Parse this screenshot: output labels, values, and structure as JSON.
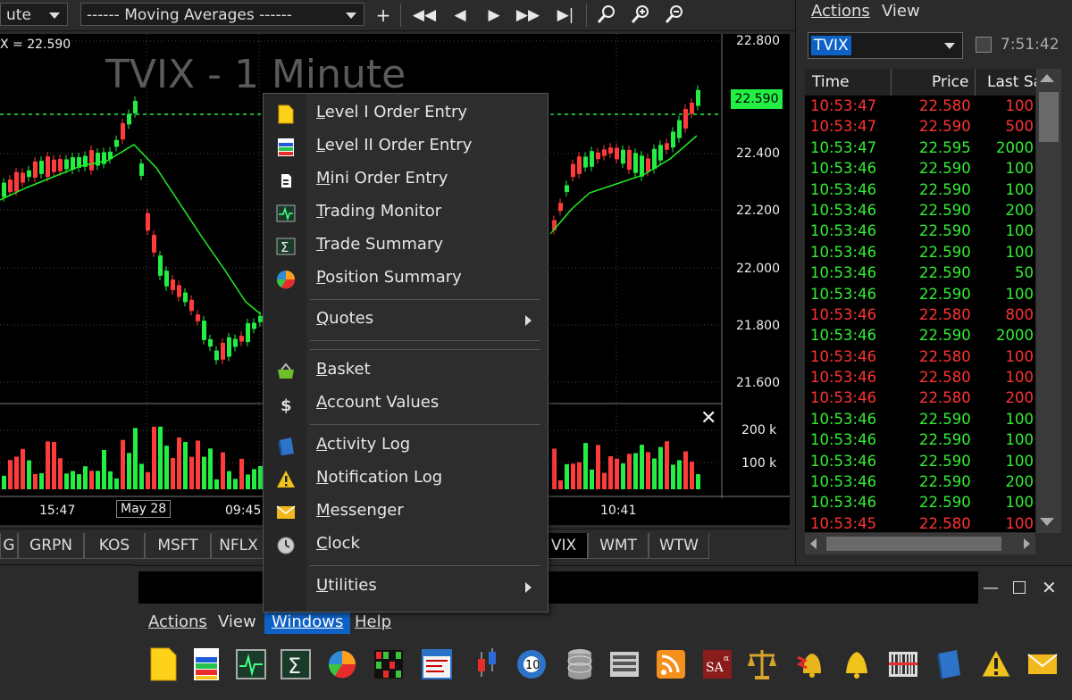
{
  "toolbar": {
    "interval_value": "ute",
    "study_value": "------  Moving Averages  ------",
    "icons": [
      "plus-icon",
      "rewind-icon",
      "step-back-icon",
      "play-icon",
      "fast-forward-icon",
      "skip-end-icon",
      "zoom-icon",
      "zoom-in-icon",
      "zoom-out-icon"
    ]
  },
  "chart": {
    "title": "TVIX - 1 Minute",
    "readout": "X = 22.590",
    "price_labels": [
      "22.800",
      "22.400",
      "22.200",
      "22.000",
      "21.800",
      "21.600"
    ],
    "last_price": "22.590",
    "volume_labels": [
      "200 k",
      "100 k"
    ],
    "time_labels": [
      "15:47",
      "May 28",
      "09:45",
      "10:41"
    ],
    "colors": {
      "up": "#22ee44",
      "down": "#ff3b3b",
      "ma": "#22ee22",
      "last": "#22ee44"
    }
  },
  "tabs": [
    "G",
    "GRPN",
    "KOS",
    "MSFT",
    "NFLX",
    "VIX",
    "WMT",
    "WTW"
  ],
  "right_panel": {
    "menu": [
      "Actions",
      "View"
    ],
    "symbol": "TVIX",
    "clock": "7:51:42",
    "columns": [
      "Time",
      "Price",
      "Last Sa"
    ],
    "trades": [
      {
        "time": "10:53:47",
        "price": "22.580",
        "size": "100",
        "dir": "red"
      },
      {
        "time": "10:53:47",
        "price": "22.590",
        "size": "500",
        "dir": "red"
      },
      {
        "time": "10:53:47",
        "price": "22.595",
        "size": "2000",
        "dir": "green"
      },
      {
        "time": "10:53:46",
        "price": "22.590",
        "size": "100",
        "dir": "green"
      },
      {
        "time": "10:53:46",
        "price": "22.590",
        "size": "100",
        "dir": "green"
      },
      {
        "time": "10:53:46",
        "price": "22.590",
        "size": "200",
        "dir": "green"
      },
      {
        "time": "10:53:46",
        "price": "22.590",
        "size": "100",
        "dir": "green"
      },
      {
        "time": "10:53:46",
        "price": "22.590",
        "size": "100",
        "dir": "green"
      },
      {
        "time": "10:53:46",
        "price": "22.590",
        "size": "50",
        "dir": "green"
      },
      {
        "time": "10:53:46",
        "price": "22.590",
        "size": "100",
        "dir": "green"
      },
      {
        "time": "10:53:46",
        "price": "22.580",
        "size": "800",
        "dir": "red"
      },
      {
        "time": "10:53:46",
        "price": "22.590",
        "size": "2000",
        "dir": "green"
      },
      {
        "time": "10:53:46",
        "price": "22.580",
        "size": "100",
        "dir": "red"
      },
      {
        "time": "10:53:46",
        "price": "22.580",
        "size": "100",
        "dir": "red"
      },
      {
        "time": "10:53:46",
        "price": "22.580",
        "size": "200",
        "dir": "red"
      },
      {
        "time": "10:53:46",
        "price": "22.590",
        "size": "100",
        "dir": "green"
      },
      {
        "time": "10:53:46",
        "price": "22.590",
        "size": "100",
        "dir": "green"
      },
      {
        "time": "10:53:46",
        "price": "22.590",
        "size": "100",
        "dir": "green"
      },
      {
        "time": "10:53:46",
        "price": "22.590",
        "size": "200",
        "dir": "green"
      },
      {
        "time": "10:53:46",
        "price": "22.590",
        "size": "100",
        "dir": "green"
      },
      {
        "time": "10:53:45",
        "price": "22.580",
        "size": "100",
        "dir": "red"
      }
    ]
  },
  "context_menu": {
    "items": [
      {
        "label": "Level I Order Entry",
        "icon": "document-icon"
      },
      {
        "label": "Level II Order Entry",
        "icon": "level2-icon"
      },
      {
        "label": "Mini Order Entry",
        "icon": "mini-doc-icon"
      },
      {
        "label": "Trading Monitor",
        "icon": "monitor-icon"
      },
      {
        "label": "Trade Summary",
        "icon": "sigma-icon"
      },
      {
        "label": "Position Summary",
        "icon": "pie-chart-icon"
      },
      {
        "label": "Quotes",
        "icon": "",
        "submenu": true
      },
      {
        "label": "Basket",
        "icon": "basket-icon"
      },
      {
        "label": "Account Values",
        "icon": "dollar-icon"
      },
      {
        "label": "Activity Log",
        "icon": "book-icon"
      },
      {
        "label": "Notification Log",
        "icon": "warning-icon"
      },
      {
        "label": "Messenger",
        "icon": "envelope-icon"
      },
      {
        "label": "Clock",
        "icon": "clock-icon"
      },
      {
        "label": "Utilities",
        "icon": "",
        "submenu": true
      }
    ]
  },
  "bottom_window": {
    "menu": [
      "Actions",
      "View",
      "Windows",
      "Help"
    ],
    "active_menu": "Windows",
    "icons": [
      "document-icon",
      "level2-icon",
      "monitor-icon",
      "sigma-icon",
      "pie-chart-icon",
      "grid-icon",
      "calendar-icon",
      "candles-icon",
      "ball-icon",
      "database-icon",
      "list-icon",
      "rss-icon",
      "sa-icon",
      "scales-icon",
      "bell-alert-icon",
      "bell-icon",
      "barcode-icon",
      "book-icon",
      "warning-icon",
      "envelope-icon"
    ]
  }
}
